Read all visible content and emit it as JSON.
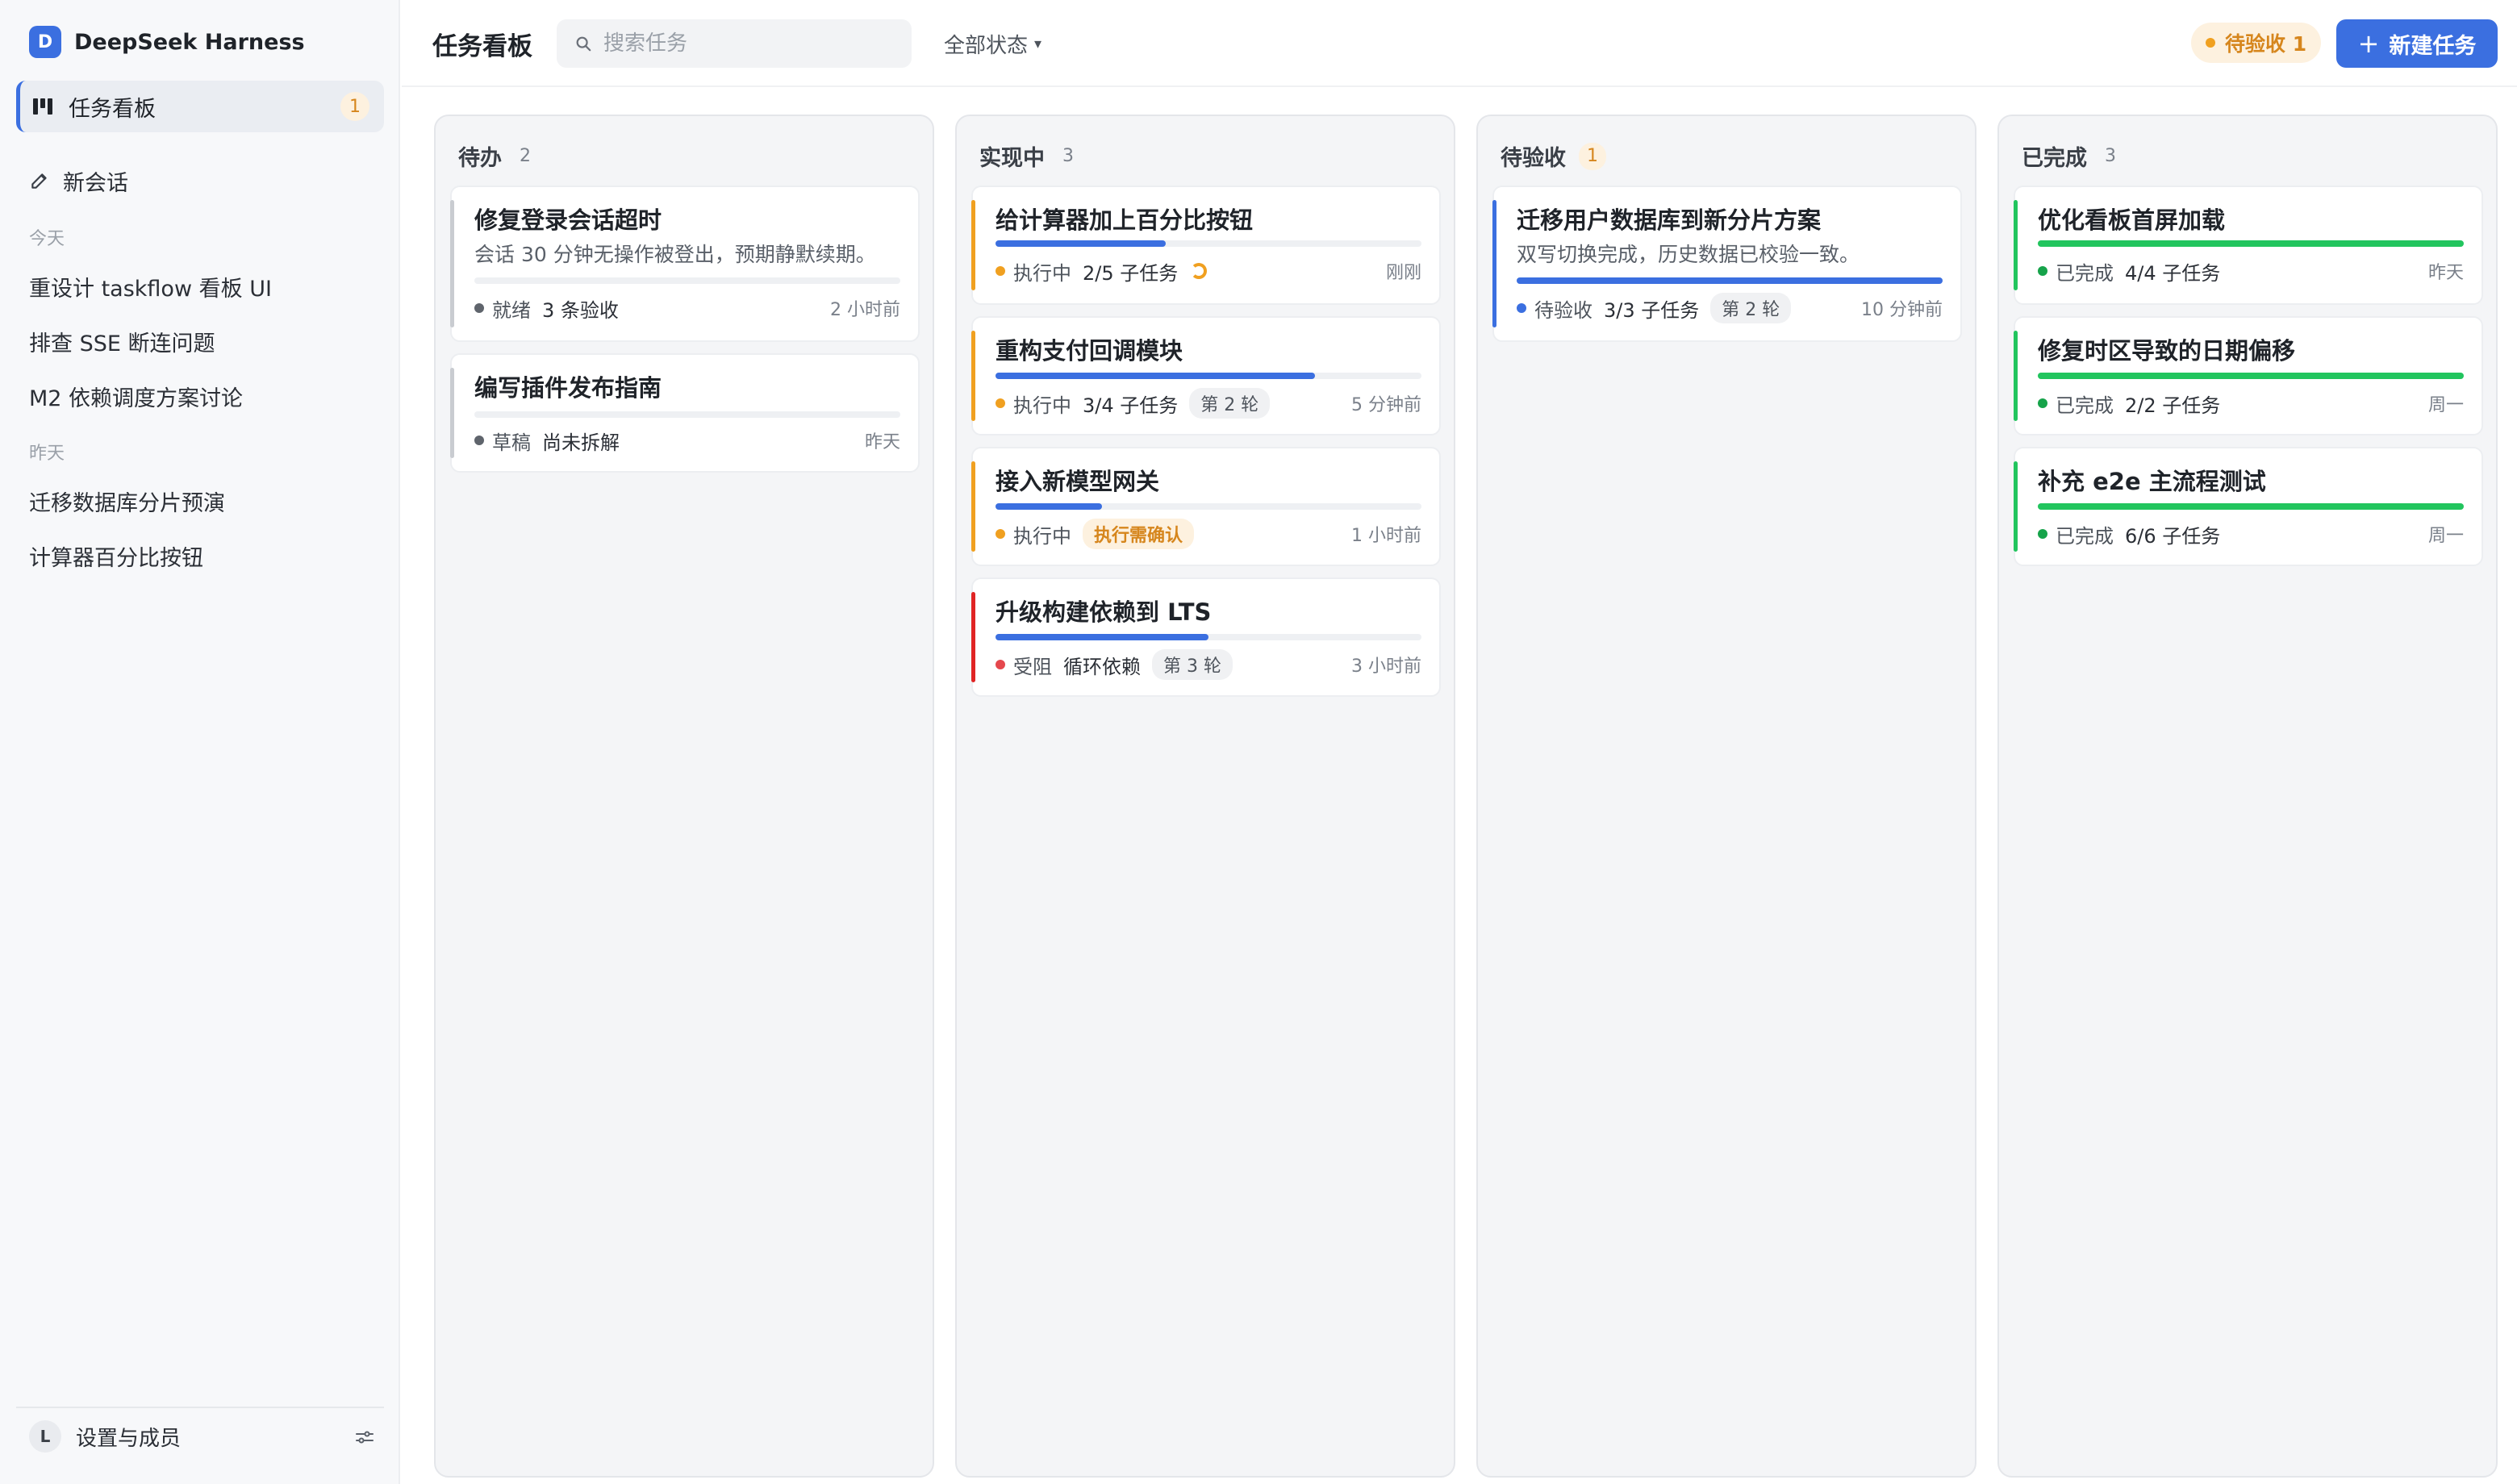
{
  "brand": {
    "logo_letter": "D",
    "name": "DeepSeek Harness"
  },
  "sidebar": {
    "active_nav": {
      "label": "任务看板",
      "badge": "1",
      "icon": "kanban-board-icon"
    },
    "new_chat": {
      "label": "新会话",
      "icon": "pencil-icon"
    },
    "groups": [
      {
        "label": "今天",
        "items": [
          "重设计 taskflow 看板 UI",
          "排查 SSE 断连问题",
          "M2 依赖调度方案讨论"
        ]
      },
      {
        "label": "昨天",
        "items": [
          "迁移数据库分片预演",
          "计算器百分比按钮"
        ]
      }
    ],
    "footer": {
      "avatar": "L",
      "label": "设置与成员",
      "icon": "sliders-icon"
    }
  },
  "topbar": {
    "title": "任务看板",
    "search": {
      "placeholder": "搜索任务",
      "value": "",
      "icon": "search-icon"
    },
    "filter": {
      "label": "全部状态",
      "caret": "▾"
    },
    "pending_pill": "待验收 1",
    "new_task": {
      "plus": "+",
      "label": "新建任务"
    }
  },
  "colors": {
    "accent": "#3b6fe0",
    "gray_status": "#5f646c",
    "orange_status": "#f0a020",
    "blue_status": "#3b6fe0",
    "red_status": "#e5484d",
    "green_status": "#22c55e"
  },
  "columns": [
    {
      "title": "待办",
      "count": "2",
      "cards": [
        {
          "title": "修复登录会话超时",
          "desc": "会话 30 分钟无操作被登出，预期静默续期。",
          "progress": 0,
          "status": "就绪",
          "sub": "3 条验收",
          "time": "2 小时前"
        },
        {
          "title": "编写插件发布指南",
          "progress": 0,
          "status": "草稿",
          "sub": "尚未拆解",
          "time": "昨天"
        }
      ]
    },
    {
      "title": "实现中",
      "count": "3",
      "cards": [
        {
          "title": "给计算器加上百分比按钮",
          "progress": 0.4,
          "status": "执行中",
          "sub": "2/5 子任务",
          "time": "刚刚"
        },
        {
          "title": "重构支付回调模块",
          "progress": 0.75,
          "status": "执行中",
          "sub": "3/4 子任务",
          "round": "第 2 轮",
          "time": "5 分钟前"
        },
        {
          "title": "接入新模型网关",
          "progress": 0.25,
          "status": "执行中",
          "warn": "执行需确认",
          "time": "1 小时前"
        },
        {
          "title": "升级构建依赖到 LTS",
          "progress": 0.5,
          "status": "受阻",
          "sub": "循环依赖",
          "round": "第 3 轮",
          "time": "3 小时前"
        }
      ]
    },
    {
      "title": "待验收",
      "count": "1",
      "cards": [
        {
          "title": "迁移用户数据库到新分片方案",
          "desc": "双写切换完成，历史数据已校验一致。",
          "progress": 1,
          "status": "待验收",
          "sub": "3/3 子任务",
          "round": "第 2 轮",
          "time": "10 分钟前"
        }
      ]
    },
    {
      "title": "已完成",
      "count": "3",
      "cards": [
        {
          "title": "优化看板首屏加载",
          "progress": 1,
          "status": "已完成",
          "sub": "4/4 子任务",
          "time": "昨天"
        },
        {
          "title": "修复时区导致的日期偏移",
          "progress": 1,
          "status": "已完成",
          "sub": "2/2 子任务",
          "time": "周一"
        },
        {
          "title": "补充 e2e 主流程测试",
          "progress": 1,
          "status": "已完成",
          "sub": "6/6 子任务",
          "time": "周一"
        }
      ]
    }
  ]
}
